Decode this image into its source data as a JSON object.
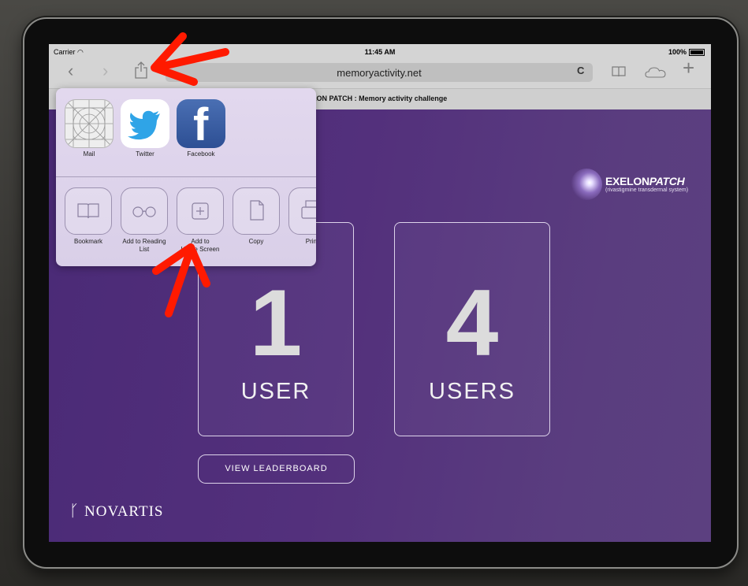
{
  "status_bar": {
    "carrier": "Carrier",
    "time": "11:45 AM",
    "battery": "100%"
  },
  "toolbar": {
    "url": "memoryactivity.net",
    "reload_glyph": "C"
  },
  "tab": {
    "title": "EXELON PATCH : Memory activity challenge"
  },
  "share_sheet": {
    "apps": [
      {
        "label": "Mail",
        "icon": "mail-icon"
      },
      {
        "label": "Twitter",
        "icon": "twitter-icon"
      },
      {
        "label": "Facebook",
        "icon": "facebook-icon"
      }
    ],
    "actions": [
      {
        "label": "Bookmark",
        "icon": "book-icon"
      },
      {
        "label": "Add to Reading\nList",
        "icon": "glasses-icon"
      },
      {
        "label": "Add to\nHome Screen",
        "icon": "plus-square-icon"
      },
      {
        "label": "Copy",
        "icon": "copy-icon"
      },
      {
        "label": "Print",
        "icon": "print-icon"
      }
    ],
    "facebook_glyph": "f"
  },
  "brand": {
    "exelon": "EXELON",
    "patch": "PATCH",
    "subtitle": "(rivastigmine transdermal system)"
  },
  "cards": [
    {
      "number": "1",
      "caption": "USER"
    },
    {
      "number": "4",
      "caption": "USERS"
    }
  ],
  "leaderboard_label": "VIEW LEADERBOARD",
  "novartis": "NOVARTIS",
  "colors": {
    "screen_purple": "#53307c",
    "arrow_red": "#ff1a00",
    "toolbar_gray": "#d4d4d4"
  }
}
